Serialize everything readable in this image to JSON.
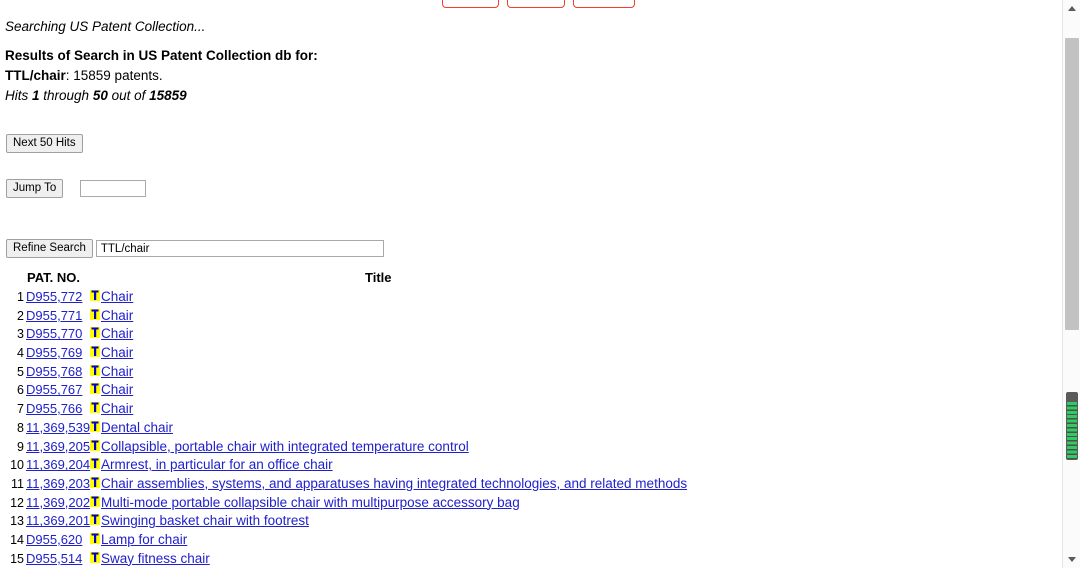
{
  "top_buttons": [
    {
      "label": "",
      "name": "red-button-1"
    },
    {
      "label": "",
      "name": "red-button-2"
    },
    {
      "label": "",
      "name": "red-button-3"
    }
  ],
  "status": {
    "searching": "Searching US Patent Collection...",
    "results_title": "Results of Search in US Patent Collection db for:",
    "query_term": "TTL/chair",
    "query_result": ": 15859 patents.",
    "hits_prefix": "Hits ",
    "hits_from": "1",
    "hits_mid": " through ",
    "hits_to": "50",
    "hits_outof": " out of ",
    "hits_total": "15859"
  },
  "controls": {
    "next_hits_label": "Next 50 Hits",
    "jump_to_label": "Jump To",
    "jump_to_value": "",
    "jump_to_placeholder": "",
    "refine_search_label": "Refine Search",
    "refine_search_value": "TTL/chair",
    "refine_search_placeholder": ""
  },
  "table": {
    "headers": {
      "pat_no": "PAT. NO.",
      "title": "Title"
    },
    "icon_name": "full-text-T-icon",
    "rows": [
      {
        "index": "1",
        "pat_no": "D955,772",
        "title": "Chair"
      },
      {
        "index": "2",
        "pat_no": "D955,771",
        "title": "Chair"
      },
      {
        "index": "3",
        "pat_no": "D955,770",
        "title": "Chair"
      },
      {
        "index": "4",
        "pat_no": "D955,769",
        "title": "Chair"
      },
      {
        "index": "5",
        "pat_no": "D955,768",
        "title": "Chair"
      },
      {
        "index": "6",
        "pat_no": "D955,767",
        "title": "Chair"
      },
      {
        "index": "7",
        "pat_no": "D955,766",
        "title": "Chair"
      },
      {
        "index": "8",
        "pat_no": "11,369,539",
        "title": "Dental chair"
      },
      {
        "index": "9",
        "pat_no": "11,369,205",
        "title": "Collapsible, portable chair with integrated temperature control"
      },
      {
        "index": "10",
        "pat_no": "11,369,204",
        "title": "Armrest, in particular for an office chair"
      },
      {
        "index": "11",
        "pat_no": "11,369,203",
        "title": "Chair assemblies, systems, and apparatuses having integrated technologies, and related methods"
      },
      {
        "index": "12",
        "pat_no": "11,369,202",
        "title": "Multi-mode portable collapsible chair with multipurpose accessory bag"
      },
      {
        "index": "13",
        "pat_no": "11,369,201",
        "title": "Swinging basket chair with footrest"
      },
      {
        "index": "14",
        "pat_no": "D955,620",
        "title": "Lamp for chair"
      },
      {
        "index": "15",
        "pat_no": "D955,514",
        "title": "Sway fitness chair"
      }
    ]
  },
  "colors": {
    "link": "#2020cc",
    "red_button_border": "#f23d2e",
    "icon_background": "#ffff00",
    "icon_glyph": "#0000cc",
    "scrollbar_thumb_outer": "#c2c2c2",
    "scrollbar_thumb_inner": "#5b5b5b",
    "scrollbar_stripe": "#2ecc62"
  }
}
